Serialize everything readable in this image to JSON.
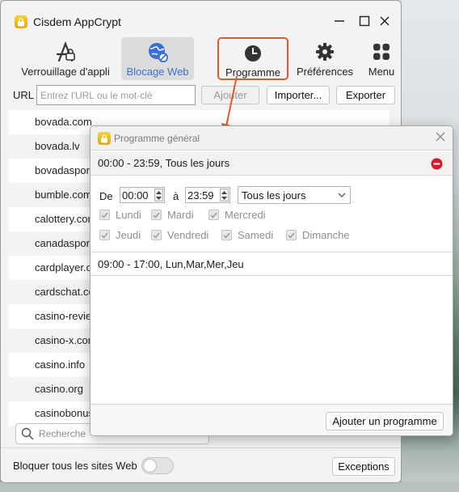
{
  "window": {
    "title": "Cisdem AppCrypt"
  },
  "toolbar": {
    "app_lock": "Verrouillage d'appli",
    "web_block": "Blocage Web",
    "schedule": "Programme",
    "preferences": "Préférences",
    "menu": "Menu"
  },
  "url_bar": {
    "label": "URL",
    "placeholder": "Entrez l'URL ou le mot-clé",
    "add": "Ajouter",
    "import": "Importer...",
    "export": "Exporter"
  },
  "sites": [
    "bovada.com",
    "bovada.lv",
    "bovadasports.com",
    "bumble.com",
    "calottery.com",
    "canadasportsbetting.ca",
    "cardplayer.com",
    "cardschat.com",
    "casino-reviews.net",
    "casino-x.com",
    "casino.info",
    "casino.org",
    "casinobonus.com"
  ],
  "search": {
    "placeholder": "Recherche"
  },
  "footer": {
    "block_all_label": "Bloquer tous les sites Web",
    "block_all_on": false,
    "exceptions": "Exceptions"
  },
  "dialog": {
    "title": "Programme général",
    "schedule1": "00:00 - 23:59, Tous les jours",
    "from_label": "De",
    "from_time": "00:00",
    "to_label": "à",
    "to_time": "23:59",
    "repeat": "Tous les jours",
    "days": [
      "Lundi",
      "Mardi",
      "Mercredi",
      "Jeudi",
      "Vendredi",
      "Samedi",
      "Dimanche"
    ],
    "schedule2": "09:00 - 17:00, Lun,Mar,Mer,Jeu",
    "add_schedule": "Ajouter un programme"
  },
  "colors": {
    "accent_blue": "#3b6fd8",
    "highlight_orange": "#e25a2b",
    "remove_red": "#d11a2a"
  }
}
